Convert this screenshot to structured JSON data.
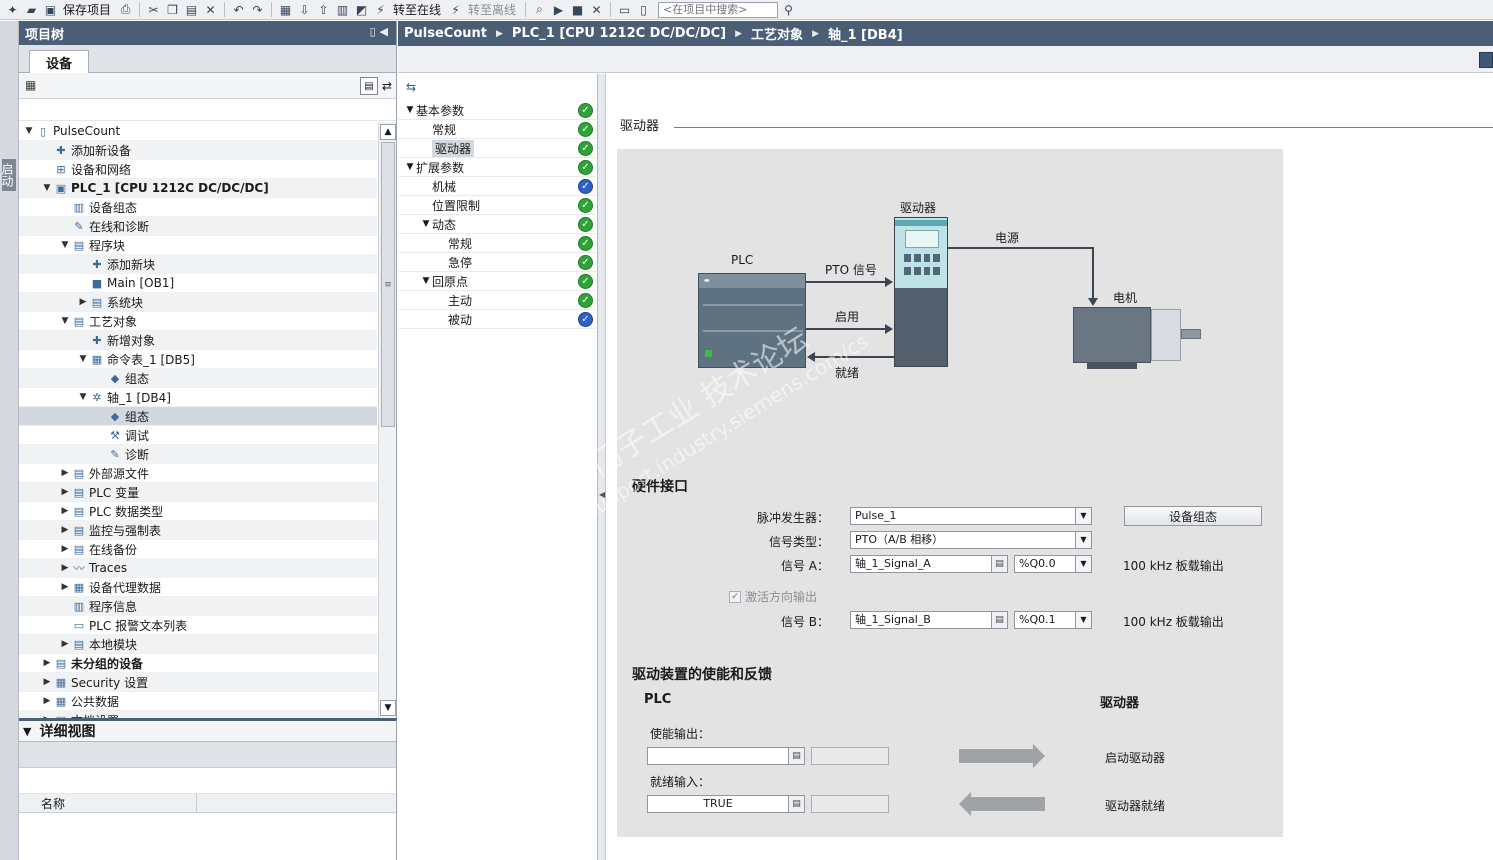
{
  "toolbar": {
    "save_label": "保存项目",
    "go_online_label": "转至在线",
    "go_offline_label": "转至离线",
    "search_placeholder": "<在项目中搜索>"
  },
  "left_strip": {
    "label": "启动"
  },
  "project_tree": {
    "title": "项目树",
    "tab": "设备",
    "items": [
      {
        "label": "PulseCount",
        "level": 0,
        "toggle": "▼",
        "icon": "project-icon",
        "glyph": "▯"
      },
      {
        "label": "添加新设备",
        "level": 1,
        "toggle": "",
        "icon": "add-device-icon",
        "glyph": "✚"
      },
      {
        "label": "设备和网络",
        "level": 1,
        "toggle": "",
        "icon": "network-icon",
        "glyph": "⊞"
      },
      {
        "label": "PLC_1 [CPU 1212C DC/DC/DC]",
        "level": 1,
        "toggle": "▼",
        "icon": "plc-icon",
        "glyph": "▣",
        "bold": true
      },
      {
        "label": "设备组态",
        "level": 2,
        "toggle": "",
        "icon": "device-config-icon",
        "glyph": "▥"
      },
      {
        "label": "在线和诊断",
        "level": 2,
        "toggle": "",
        "icon": "diagnostics-icon",
        "glyph": "✎"
      },
      {
        "label": "程序块",
        "level": 2,
        "toggle": "▼",
        "icon": "folder-icon",
        "glyph": "▤"
      },
      {
        "label": "添加新块",
        "level": 3,
        "toggle": "",
        "icon": "add-block-icon",
        "glyph": "✚"
      },
      {
        "label": "Main [OB1]",
        "level": 3,
        "toggle": "",
        "icon": "ob-icon",
        "glyph": "■"
      },
      {
        "label": "系统块",
        "level": 3,
        "toggle": "▶",
        "icon": "folder-icon",
        "glyph": "▤"
      },
      {
        "label": "工艺对象",
        "level": 2,
        "toggle": "▼",
        "icon": "folder-icon",
        "glyph": "▤"
      },
      {
        "label": "新增对象",
        "level": 3,
        "toggle": "",
        "icon": "add-object-icon",
        "glyph": "✚"
      },
      {
        "label": "命令表_1 [DB5]",
        "level": 3,
        "toggle": "▼",
        "icon": "command-table-icon",
        "glyph": "▦"
      },
      {
        "label": "组态",
        "level": 4,
        "toggle": "",
        "icon": "config-icon",
        "glyph": "◆"
      },
      {
        "label": "轴_1 [DB4]",
        "level": 3,
        "toggle": "▼",
        "icon": "axis-icon",
        "glyph": "✲"
      },
      {
        "label": "组态",
        "level": 4,
        "toggle": "",
        "icon": "config-icon",
        "glyph": "◆",
        "selected": true
      },
      {
        "label": "调试",
        "level": 4,
        "toggle": "",
        "icon": "commissioning-icon",
        "glyph": "⚒"
      },
      {
        "label": "诊断",
        "level": 4,
        "toggle": "",
        "icon": "diagnostics-icon",
        "glyph": "✎"
      },
      {
        "label": "外部源文件",
        "level": 2,
        "toggle": "▶",
        "icon": "folder-icon",
        "glyph": "▤"
      },
      {
        "label": "PLC 变量",
        "level": 2,
        "toggle": "▶",
        "icon": "folder-icon",
        "glyph": "▤"
      },
      {
        "label": "PLC 数据类型",
        "level": 2,
        "toggle": "▶",
        "icon": "folder-icon",
        "glyph": "▤"
      },
      {
        "label": "监控与强制表",
        "level": 2,
        "toggle": "▶",
        "icon": "folder-icon",
        "glyph": "▤"
      },
      {
        "label": "在线备份",
        "level": 2,
        "toggle": "▶",
        "icon": "folder-icon",
        "glyph": "▤"
      },
      {
        "label": "Traces",
        "level": 2,
        "toggle": "▶",
        "icon": "traces-icon",
        "glyph": "〰"
      },
      {
        "label": "设备代理数据",
        "level": 2,
        "toggle": "▶",
        "icon": "proxy-icon",
        "glyph": "▦"
      },
      {
        "label": "程序信息",
        "level": 2,
        "toggle": "",
        "icon": "program-info-icon",
        "glyph": "▥"
      },
      {
        "label": "PLC 报警文本列表",
        "level": 2,
        "toggle": "",
        "icon": "alarm-text-icon",
        "glyph": "▭"
      },
      {
        "label": "本地模块",
        "level": 2,
        "toggle": "▶",
        "icon": "folder-icon",
        "glyph": "▤"
      },
      {
        "label": "未分组的设备",
        "level": 1,
        "toggle": "▶",
        "icon": "ungrouped-icon",
        "glyph": "▤",
        "bold": true
      },
      {
        "label": "Security 设置",
        "level": 1,
        "toggle": "▶",
        "icon": "security-icon",
        "glyph": "▦"
      },
      {
        "label": "公共数据",
        "level": 1,
        "toggle": "▶",
        "icon": "common-data-icon",
        "glyph": "▦"
      },
      {
        "label": "文档设置",
        "level": 1,
        "toggle": "▶",
        "icon": "document-icon",
        "glyph": "▤"
      }
    ]
  },
  "detail_view": {
    "title": "详细视图",
    "column_name": "名称"
  },
  "breadcrumb": [
    "PulseCount",
    "PLC_1 [CPU 1212C DC/DC/DC]",
    "工艺对象",
    "轴_1 [DB4]"
  ],
  "config_nav": [
    {
      "label": "基本参数",
      "level": 0,
      "toggle": "▼",
      "status": "green"
    },
    {
      "label": "常规",
      "level": 1,
      "toggle": "",
      "status": "green"
    },
    {
      "label": "驱动器",
      "level": 1,
      "toggle": "",
      "status": "green",
      "selected": true
    },
    {
      "label": "扩展参数",
      "level": 0,
      "toggle": "▼",
      "status": "green"
    },
    {
      "label": "机械",
      "level": 1,
      "toggle": "",
      "status": "blue"
    },
    {
      "label": "位置限制",
      "level": 1,
      "toggle": "",
      "status": "green"
    },
    {
      "label": "动态",
      "level": 1,
      "toggle": "▼",
      "status": "green"
    },
    {
      "label": "常规",
      "level": 2,
      "toggle": "",
      "status": "green"
    },
    {
      "label": "急停",
      "level": 2,
      "toggle": "",
      "status": "green"
    },
    {
      "label": "回原点",
      "level": 1,
      "toggle": "▼",
      "status": "green"
    },
    {
      "label": "主动",
      "level": 2,
      "toggle": "",
      "status": "green"
    },
    {
      "label": "被动",
      "level": 2,
      "toggle": "",
      "status": "blue"
    }
  ],
  "main": {
    "section_title": "驱动器",
    "diagram": {
      "plc": "PLC",
      "drive": "驱动器",
      "motor": "电机",
      "power": "电源",
      "pto_signal": "PTO 信号",
      "enable": "启用",
      "ready": "就绪"
    },
    "hardware": {
      "heading": "硬件接口",
      "pulse_gen_label": "脉冲发生器：",
      "pulse_gen_value": "Pulse_1",
      "device_config_button": "设备组态",
      "signal_type_label": "信号类型：",
      "signal_type_value": "PTO（A/B 相移）",
      "signal_a_label": "信号 A：",
      "signal_a_value": "轴_1_Signal_A",
      "signal_a_address": "%Q0.0",
      "signal_a_note": "100 kHz 板载输出",
      "activate_dir_label": "激活方向输出",
      "signal_b_label": "信号 B：",
      "signal_b_value": "轴_1_Signal_B",
      "signal_b_address": "%Q0.1",
      "signal_b_note": "100 kHz 板载输出"
    },
    "enable_feedback": {
      "heading": "驱动装置的使能和反馈",
      "plc_label": "PLC",
      "drive_label": "驱动器",
      "enable_output_label": "使能输出：",
      "enable_output_value": "",
      "ready_input_label": "就绪输入：",
      "ready_input_value": "TRUE",
      "enable_drive_label": "启动驱动器",
      "drive_ready_label": "驱动器就绪"
    },
    "watermark_line1": "西门子工业 技术论坛",
    "watermark_line2": "support.industry.siemens.com/cs"
  }
}
